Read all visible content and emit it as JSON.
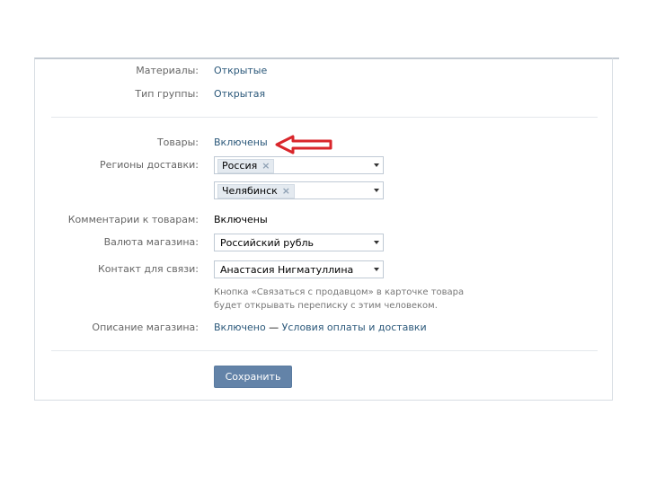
{
  "form": {
    "materials": {
      "label": "Материалы:",
      "value": "Открытые"
    },
    "group_type": {
      "label": "Тип группы:",
      "value": "Открытая"
    },
    "goods": {
      "label": "Товары:",
      "value": "Включены"
    },
    "regions": {
      "label": "Регионы доставки:",
      "tokens": [
        "Россия",
        "Челябинск"
      ]
    },
    "comments": {
      "label": "Комментарии к товарам:",
      "value": "Включены"
    },
    "currency": {
      "label": "Валюта магазина:",
      "value": "Российский рубль"
    },
    "contact": {
      "label": "Контакт для связи:",
      "value": "Анастасия Нигматуллина",
      "hint_line1": "Кнопка «Связаться с продавцом» в карточке товара",
      "hint_line2": "будет открывать переписку с этим человеком."
    },
    "description": {
      "label": "Описание магазина:",
      "value": "Включено",
      "dash": " — ",
      "link": "Условия оплаты и доставки"
    },
    "save_label": "Сохранить"
  },
  "colors": {
    "annotation_arrow": "#d9262b",
    "accent": "#2b587a",
    "button": "#6383a8"
  }
}
